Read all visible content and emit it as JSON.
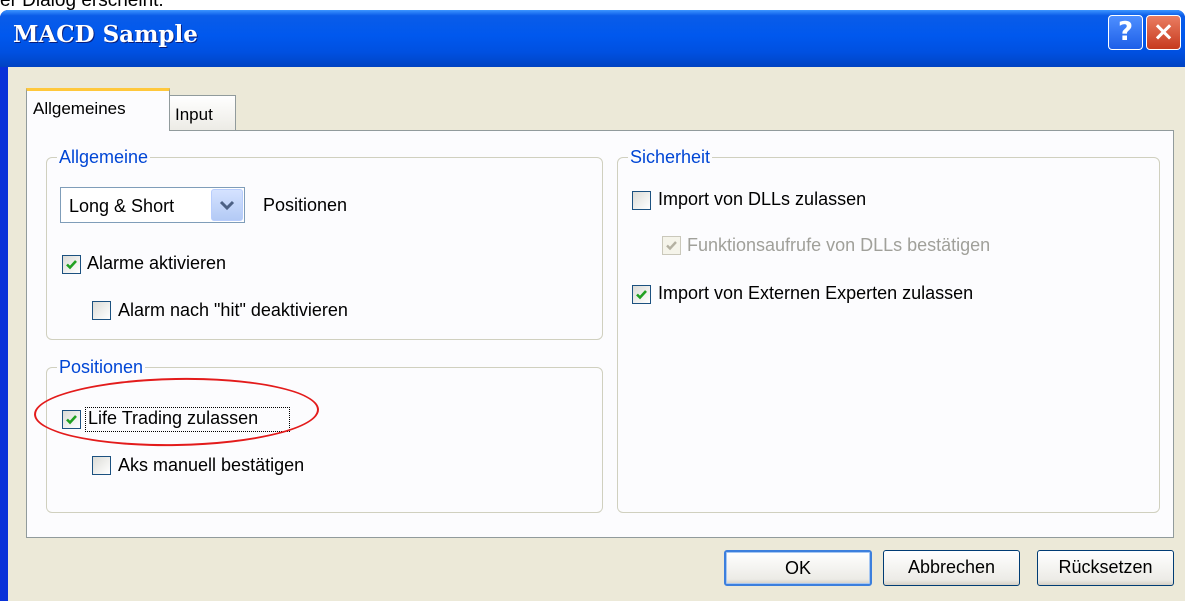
{
  "page": {
    "caption_fragment": "er Dialog erscheint:"
  },
  "window": {
    "title": "MACD Sample",
    "help_glyph": "?",
    "close_glyph": "×"
  },
  "tabs": [
    {
      "label": "Allgemeines",
      "active": true
    },
    {
      "label": "Input",
      "active": false
    }
  ],
  "general_group": {
    "legend": "Allgemeine",
    "positions_select": {
      "value": "Long & Short",
      "label": "Positionen"
    },
    "enable_alerts": {
      "label": "Alarme aktivieren",
      "checked": true
    },
    "disable_alarm_after_hit": {
      "label": "Alarm nach \"hit\" deaktivieren",
      "checked": false
    }
  },
  "positions_group": {
    "legend": "Positionen",
    "allow_live_trading": {
      "label": "Life Trading zulassen",
      "checked": true
    },
    "manual_confirm": {
      "label": "Aks manuell bestätigen",
      "checked": false
    }
  },
  "security_group": {
    "legend": "Sicherheit",
    "allow_dll_import": {
      "label": "Import von DLLs zulassen",
      "checked": false
    },
    "confirm_dll_calls": {
      "label": "Funktionsaufrufe von DLLs bestätigen",
      "checked": true,
      "disabled": true
    },
    "allow_external_experts": {
      "label": "Import von Externen Experten zulassen",
      "checked": true
    }
  },
  "buttons": {
    "ok": "OK",
    "cancel": "Abbrechen",
    "reset": "Rücksetzen"
  },
  "colors": {
    "titlebar": "#0058ee",
    "client_background": "#ece9d8",
    "legend_text": "#0046d5",
    "checkmark": "#21a121",
    "annotation_ellipse": "#e31b1b"
  },
  "icons": {
    "help": "help-icon",
    "close": "close-icon",
    "dropdown": "chevron-down-icon",
    "checkmark": "checkmark-icon"
  }
}
